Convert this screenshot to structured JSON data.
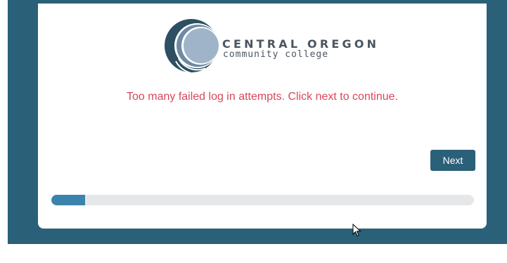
{
  "logo": {
    "line1": "CENTRAL OREGON",
    "line2": "community college",
    "icon": "college-logo-circles"
  },
  "message": "Too many failed log in attempts. Click next to continue.",
  "next_label": "Next",
  "progress": {
    "percent": 8
  },
  "colors": {
    "backdrop": "#2b6079",
    "message": "#d9465b",
    "button": "#2b6079",
    "progress_fill": "#3b83ad",
    "progress_track": "#e6e7e9"
  }
}
